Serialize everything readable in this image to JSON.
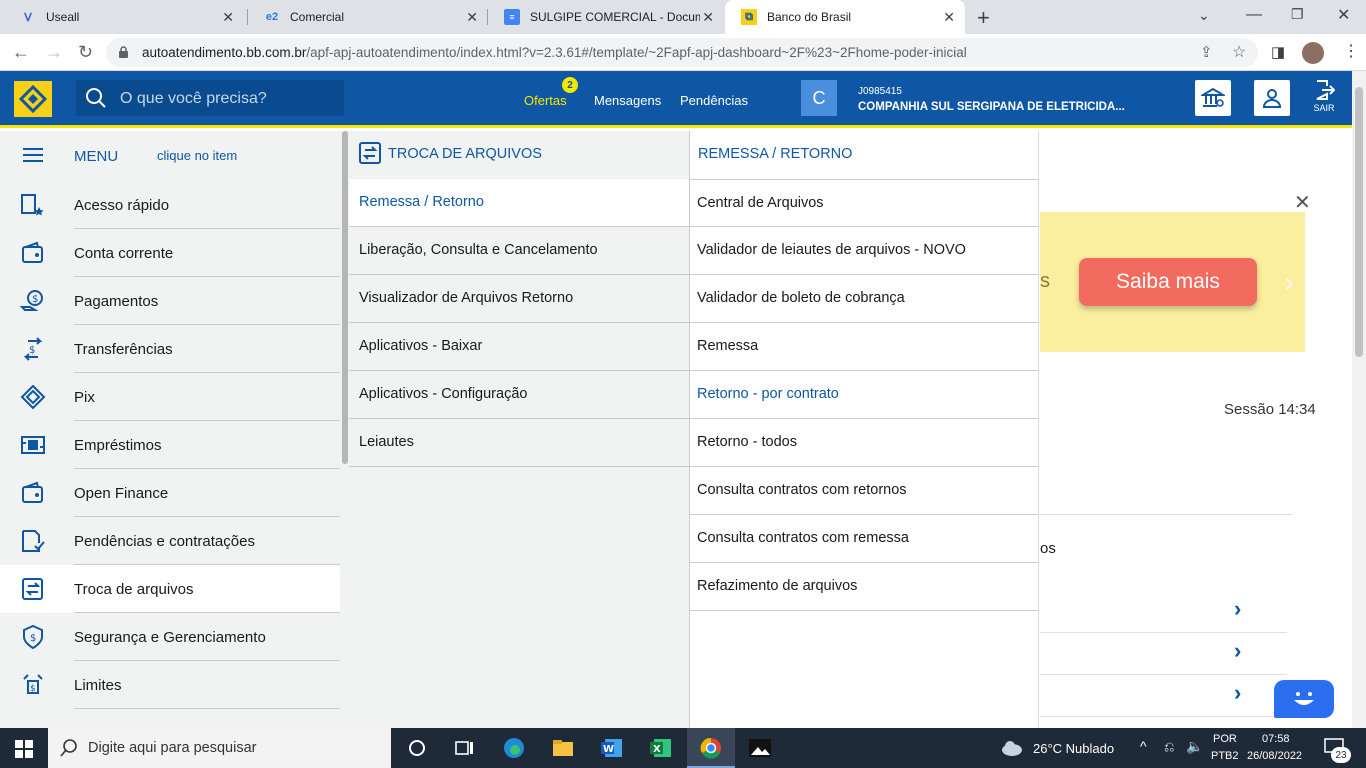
{
  "browser": {
    "tabs": [
      {
        "title": "Useall",
        "icon": "useall-icon",
        "active": false
      },
      {
        "title": "Comercial",
        "icon": "comercial-icon",
        "active": false
      },
      {
        "title": "SULGIPE COMERCIAL - Documen",
        "icon": "docs-icon",
        "active": false
      },
      {
        "title": "Banco do Brasil",
        "icon": "bb-icon",
        "active": true
      }
    ],
    "url_host": "autoatendimento.bb.com.br",
    "url_path": "/apf-apj-autoatendimento/index.html?v=2.3.61#/template/~2Fapf-apj-dashboard~2F%23~2Fhome-poder-inicial"
  },
  "header": {
    "search_placeholder": "O que você precisa?",
    "nav": {
      "ofertas": "Ofertas",
      "ofertas_badge": "2",
      "mensagens": "Mensagens",
      "pendencias": "Pendências"
    },
    "account": {
      "initial": "C",
      "code": "J0985415",
      "company": "COMPANHIA SUL SERGIPANA DE ELETRICIDA..."
    },
    "sair": "SAIR"
  },
  "sidebar": {
    "menu_label": "MENU",
    "hint": "clique no item",
    "items": [
      {
        "label": "Acesso rápido",
        "icon": "quick-access-icon"
      },
      {
        "label": "Conta corrente",
        "icon": "wallet-icon"
      },
      {
        "label": "Pagamentos",
        "icon": "payments-icon"
      },
      {
        "label": "Transferências",
        "icon": "transfer-icon"
      },
      {
        "label": "Pix",
        "icon": "pix-icon"
      },
      {
        "label": "Empréstimos",
        "icon": "loan-icon"
      },
      {
        "label": "Open Finance",
        "icon": "open-finance-icon"
      },
      {
        "label": "Pendências e contratações",
        "icon": "document-check-icon"
      },
      {
        "label": "Troca de arquivos",
        "icon": "file-exchange-icon"
      },
      {
        "label": "Segurança e Gerenciamento",
        "icon": "shield-dollar-icon"
      },
      {
        "label": "Limites",
        "icon": "limits-icon"
      }
    ]
  },
  "submenu": {
    "title": "TROCA DE ARQUIVOS",
    "items": [
      "Remessa / Retorno",
      "Liberação, Consulta e Cancelamento",
      "Visualizador de Arquivos Retorno",
      "Aplicativos - Baixar",
      "Aplicativos - Configuração",
      "Leiautes"
    ]
  },
  "subsubmenu": {
    "title": "REMESSA / RETORNO",
    "items": [
      "Central de Arquivos",
      "Validador de leiautes de arquivos - NOVO",
      "Validador de boleto de cobrança",
      "Remessa",
      "Retorno - por contrato",
      "Retorno - todos",
      "Consulta contratos com retornos",
      "Consulta contratos com remessa",
      "Refazimento de arquivos"
    ]
  },
  "page": {
    "banner_button": "Saiba mais",
    "banner_fragment": "s",
    "session": "Sessão 14:34",
    "card_fragment": "os"
  },
  "taskbar": {
    "search_placeholder": "Digite aqui para pesquisar",
    "weather": "26°C  Nublado",
    "lang1": "POR",
    "lang2": "PTB2",
    "time": "07:58",
    "date": "26/08/2022",
    "notifications": "23"
  },
  "colors": {
    "bb_blue": "#0f57a5",
    "bb_yellow": "#f6e600",
    "banner_bg": "#fbee9f",
    "cta": "#f26b5e"
  }
}
